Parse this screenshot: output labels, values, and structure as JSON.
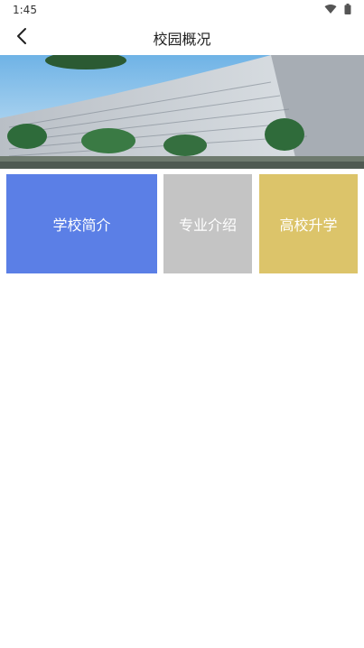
{
  "status_bar": {
    "time": "1:45",
    "icons": [
      "wifi-icon",
      "battery-icon"
    ]
  },
  "header": {
    "title": "校园概况",
    "back_icon": "chevron-left-icon"
  },
  "banner": {
    "image_semantic": "campus-building-photo"
  },
  "tiles": [
    {
      "label": "学校简介",
      "color": "#5b7fe6"
    },
    {
      "label": "专业介绍",
      "color": "#c4c4c4"
    },
    {
      "label": "高校升学",
      "color": "#dcc46a"
    }
  ]
}
